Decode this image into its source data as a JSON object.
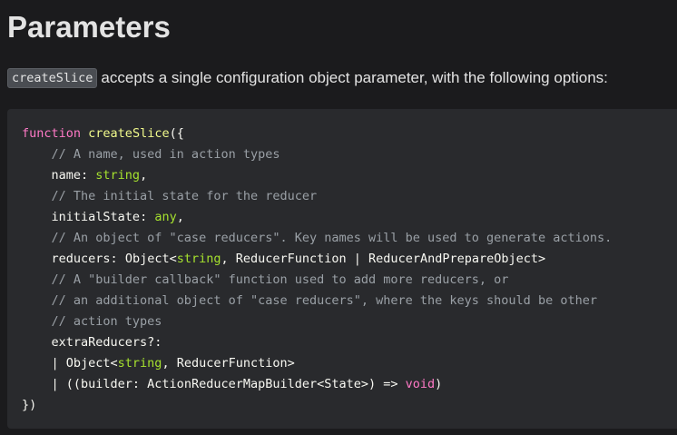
{
  "heading": "Parameters",
  "intro": {
    "code": "createSlice",
    "text": "accepts a single configuration object parameter, with the following options:"
  },
  "code": {
    "l1": {
      "kw": "function",
      "sp": " ",
      "fn": "createSlice",
      "punct": "({"
    },
    "l2": {
      "comment": "    // A name, used in action types"
    },
    "l3": {
      "indent": "    ",
      "prop": "name",
      "colon": ": ",
      "type": "string",
      "end": ","
    },
    "l4": {
      "comment": "    // The initial state for the reducer"
    },
    "l5": {
      "indent": "    ",
      "prop": "initialState",
      "colon": ": ",
      "type": "any",
      "end": ","
    },
    "l6": {
      "comment": "    // An object of \"case reducers\". Key names will be used to generate actions."
    },
    "l7": {
      "indent": "    ",
      "prop": "reducers",
      "colon": ": ",
      "obj": "Object<",
      "type": "string",
      "rest": ", ReducerFunction | ReducerAndPrepareObject>"
    },
    "l8": {
      "comment": "    // A \"builder callback\" function used to add more reducers, or"
    },
    "l9": {
      "comment": "    // an additional object of \"case reducers\", where the keys should be other"
    },
    "l10": {
      "comment": "    // action types"
    },
    "l11": {
      "indent": "    ",
      "prop": "extraReducers?:"
    },
    "l12": {
      "indent": "    ",
      "pre": "| Object<",
      "type": "string",
      "rest": ", ReducerFunction>"
    },
    "l13": {
      "indent": "    ",
      "pre": "| ((builder: ActionReducerMapBuilder<State>) => ",
      "kw": "void",
      "end": ")"
    },
    "l14": {
      "text": "})"
    }
  }
}
